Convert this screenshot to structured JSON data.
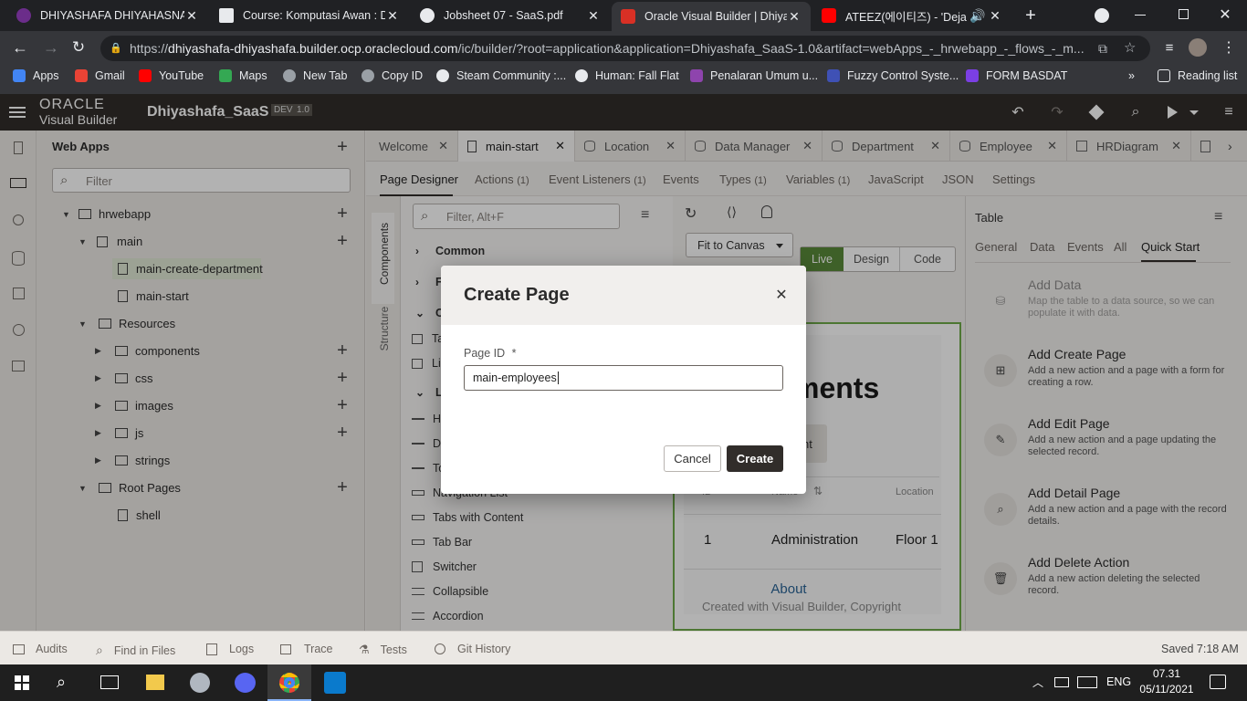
{
  "browser": {
    "tabs": [
      {
        "title": "DHIYASHAFA DHIYAHASNA H",
        "color": "#6b2d8a"
      },
      {
        "title": "Course: Komputasi Awan : Dip",
        "color": "#e8eaed"
      },
      {
        "title": "Jobsheet 07 - SaaS.pdf",
        "color": "#e8eaed"
      },
      {
        "title": "Oracle Visual Builder | Dhiyas",
        "color": "#d93025"
      },
      {
        "title": "ATEEZ(에이티즈) - 'Deja V",
        "color": "#ff0000"
      }
    ],
    "url_prefix": "https://",
    "url_host": "dhiyashafa-dhiyashafa.builder.ocp.oraclecloud.com",
    "url_path": "/ic/builder/?root=application&application=Dhiyashafa_SaaS-1.0&artifact=webApps_-_hrwebapp_-_flows_-_m...",
    "bookmarks": [
      {
        "label": "Apps",
        "color": "#4285f4"
      },
      {
        "label": "Gmail",
        "color": "#ea4335"
      },
      {
        "label": "YouTube",
        "color": "#ff0000"
      },
      {
        "label": "Maps",
        "color": "#34a853"
      },
      {
        "label": "New Tab",
        "color": "#9aa0a6"
      },
      {
        "label": "Copy ID",
        "color": "#9aa0a6"
      },
      {
        "label": "Steam Community :...",
        "color": "#1b2838"
      },
      {
        "label": "Human: Fall Flat",
        "color": "#1b2838"
      },
      {
        "label": "Penalaran Umum u...",
        "color": "#8e44ad"
      },
      {
        "label": "Fuzzy Control Syste...",
        "color": "#3f51b5"
      },
      {
        "label": "FORM BASDAT",
        "color": "#7b3fe4"
      }
    ],
    "reading_list": "Reading list"
  },
  "vb": {
    "brand_top": "ORACLE",
    "brand_bottom": "Visual Builder",
    "app_name": "Dhiyashafa_SaaS",
    "badge_dev": "DEV",
    "badge_ver": "1.0"
  },
  "nav": {
    "title": "Web Apps",
    "filter_placeholder": "Filter",
    "items": [
      {
        "label": "hrwebapp"
      },
      {
        "label": "main"
      },
      {
        "label": "main-create-department"
      },
      {
        "label": "main-start"
      },
      {
        "label": "Resources"
      },
      {
        "label": "components"
      },
      {
        "label": "css"
      },
      {
        "label": "images"
      },
      {
        "label": "js"
      },
      {
        "label": "strings"
      },
      {
        "label": "Root Pages"
      },
      {
        "label": "shell"
      }
    ]
  },
  "editor_tabs": [
    "Welcome",
    "main-start",
    "Location",
    "Data Manager",
    "Department",
    "Employee",
    "HRDiagram"
  ],
  "sub_tabs": [
    {
      "label": "Page Designer",
      "count": ""
    },
    {
      "label": "Actions",
      "count": "(1)"
    },
    {
      "label": "Event Listeners",
      "count": "(1)"
    },
    {
      "label": "Events",
      "count": ""
    },
    {
      "label": "Types",
      "count": "(1)"
    },
    {
      "label": "Variables",
      "count": "(1)"
    },
    {
      "label": "JavaScript",
      "count": ""
    },
    {
      "label": "JSON",
      "count": ""
    },
    {
      "label": "Settings",
      "count": ""
    }
  ],
  "vertical_tabs": [
    "Components",
    "Structure"
  ],
  "components": {
    "filter_placeholder": "Filter, Alt+F",
    "groups": [
      "Common",
      "F",
      "C",
      "L"
    ],
    "items_a": [
      "Ta",
      "Li"
    ],
    "items_b": [
      "H",
      "D",
      "To",
      "Navigation List",
      "Tabs with Content",
      "Tab Bar",
      "Switcher",
      "Collapsible",
      "Accordion"
    ]
  },
  "canvas": {
    "fit": "Fit to Canvas",
    "modes": [
      "Live",
      "Design",
      "Code"
    ],
    "heading": "ments",
    "button_fragment": "nt",
    "col_id": "ID",
    "col_name": "Name",
    "col_location": "Location",
    "row_id": "1",
    "row_name": "Administration",
    "row_location": "Floor 1",
    "footer_about": "About",
    "footer_copy": "Created with Visual Builder, Copyright"
  },
  "props": {
    "title": "Table",
    "tabs": [
      "General",
      "Data",
      "Events",
      "All",
      "Quick Start"
    ],
    "quickstart": [
      {
        "title": "Add Data",
        "desc": "Map the table to a data source, so we can populate it with data.",
        "disabled": true
      },
      {
        "title": "Add Create Page",
        "desc": "Add a new action and a page with a form for creating a row."
      },
      {
        "title": "Add Edit Page",
        "desc": "Add a new action and a page updating the selected record."
      },
      {
        "title": "Add Detail Page",
        "desc": "Add a new action and a page with the record details."
      },
      {
        "title": "Add Delete Action",
        "desc": "Add a new action deleting the selected record."
      }
    ]
  },
  "status": {
    "items": [
      "Audits",
      "Find in Files",
      "Logs",
      "Trace",
      "Tests",
      "Git History"
    ],
    "saved": "Saved 7:18 AM"
  },
  "taskbar": {
    "lang": "ENG",
    "time": "07.31",
    "date": "05/11/2021"
  },
  "dialog": {
    "title": "Create Page",
    "field_label": "Page ID",
    "required": "*",
    "field_value": "main-employees",
    "cancel": "Cancel",
    "create": "Create"
  }
}
